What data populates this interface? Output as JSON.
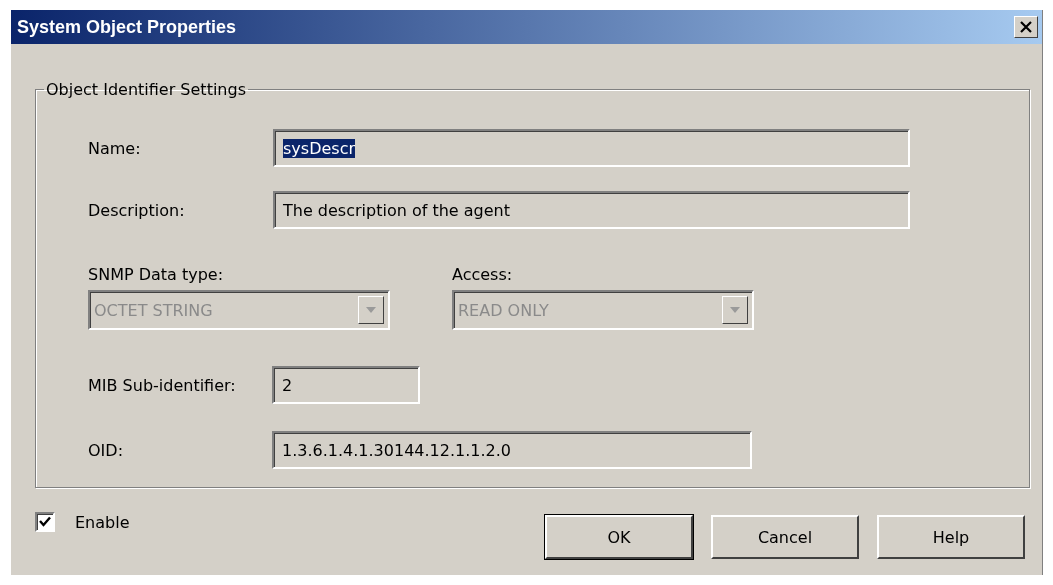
{
  "window": {
    "title": "System Object Properties"
  },
  "group": {
    "title": "Object Identifier Settings"
  },
  "name_field": {
    "label": "Name:",
    "value": "sysDescr",
    "selected": true
  },
  "description_field": {
    "label": "Description:",
    "value": "The description of the agent",
    "selected": false
  },
  "data_type": {
    "label": "SNMP Data type:",
    "value": "OCTET STRING",
    "disabled": true
  },
  "access": {
    "label": "Access:",
    "value": "READ ONLY",
    "disabled": true
  },
  "mib_sub_identifier": {
    "label": "MIB Sub-identifier:",
    "value": "2",
    "selected": false
  },
  "oid": {
    "label": "OID:",
    "value": "1.3.6.1.4.1.30144.12.1.1.2.0",
    "selected": false
  },
  "enable": {
    "label": "Enable",
    "checked": true
  },
  "buttons": [
    {
      "label": "OK",
      "default": true
    },
    {
      "label": "Cancel",
      "default": false
    },
    {
      "label": "Help",
      "default": false
    }
  ]
}
